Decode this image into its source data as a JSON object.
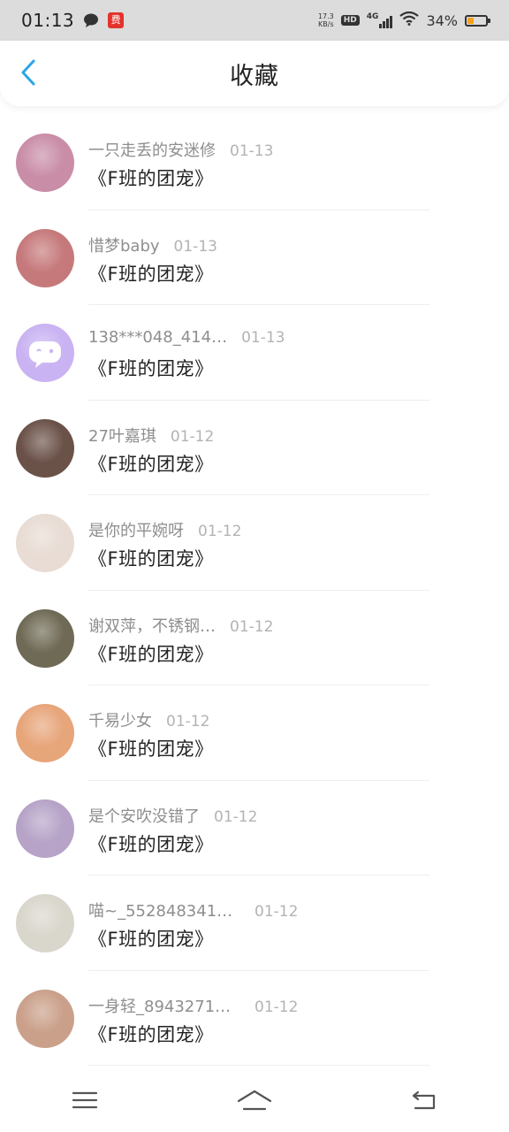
{
  "status_bar": {
    "time": "01:13",
    "net_speed_value": "17.3",
    "net_speed_unit": "KB/s",
    "hd_label": "HD",
    "network_type": "4G",
    "battery_percent": "34%",
    "battery_level": 0.34,
    "app_icon_text": "费"
  },
  "header": {
    "title": "收藏"
  },
  "items": [
    {
      "name": "一只走丢的安迷修",
      "date": "01-13",
      "title": "《F班的团宠》",
      "avatar_color": "#c98da8"
    },
    {
      "name": "惜梦baby",
      "date": "01-13",
      "title": "《F班的团宠》",
      "avatar_color": "#c6797b"
    },
    {
      "name": "138***048_414…",
      "date": "01-13",
      "title": "《F班的团宠》",
      "avatar_color": "#c9b3f2"
    },
    {
      "name": "27叶嘉琪",
      "date": "01-12",
      "title": "《F班的团宠》",
      "avatar_color": "#6b5249"
    },
    {
      "name": "是你的平婉呀",
      "date": "01-12",
      "title": "《F班的团宠》",
      "avatar_color": "#e8dcd4"
    },
    {
      "name": "谢双萍，不锈钢…",
      "date": "01-12",
      "title": "《F班的团宠》",
      "avatar_color": "#6f6a55"
    },
    {
      "name": "千易少女",
      "date": "01-12",
      "title": "《F班的团宠》",
      "avatar_color": "#e7a57a"
    },
    {
      "name": "是个安吹没错了",
      "date": "01-12",
      "title": "《F班的团宠》",
      "avatar_color": "#b6a3c7"
    },
    {
      "name": "喵~_552848341…",
      "date": "01-12",
      "title": "《F班的团宠》",
      "avatar_color": "#d9d6cc"
    },
    {
      "name": "一身轻_8943271…",
      "date": "01-12",
      "title": "《F班的团宠》",
      "avatar_color": "#caa08a"
    }
  ]
}
